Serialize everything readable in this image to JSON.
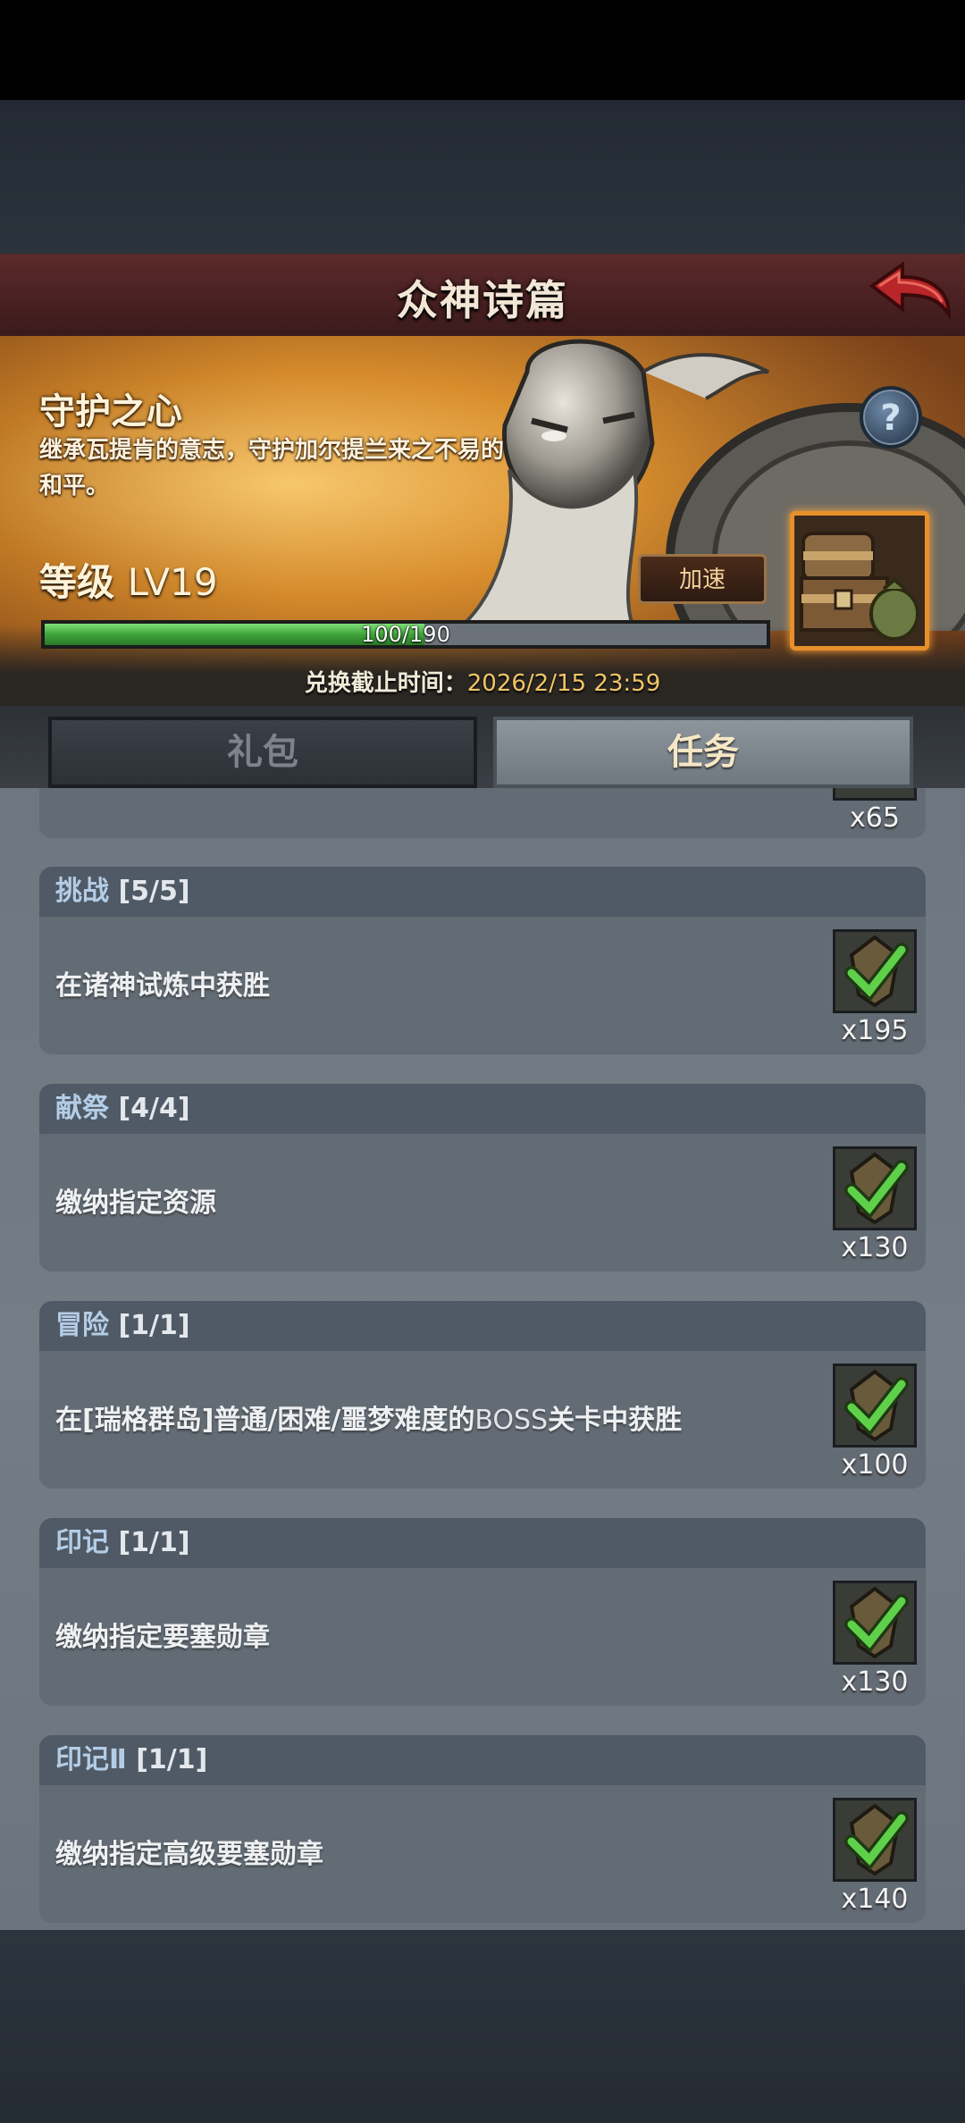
{
  "header": {
    "title": "众神诗篇"
  },
  "banner": {
    "title": "守护之心",
    "description": "继承瓦提肯的意志，守护加尔提兰来之不易的和平。",
    "level_label": "等级",
    "level_value": "LV19",
    "speed_button": "加速",
    "help_glyph": "?",
    "progress_text": "100/190",
    "progress_fraction": 0.526,
    "deadline_label": "兑换截止时间：",
    "deadline_value": "2026/2/15 23:59"
  },
  "tabs": [
    {
      "label": "礼包",
      "active": false
    },
    {
      "label": "任务",
      "active": true
    }
  ],
  "partial_top_qty": "x65",
  "tasks": [
    {
      "category": "挑战",
      "count": "[5/5]",
      "description": "在诸神试炼中获胜",
      "qty": "x195",
      "completed": true
    },
    {
      "category": "献祭",
      "count": "[4/4]",
      "description": "缴纳指定资源",
      "qty": "x130",
      "completed": true
    },
    {
      "category": "冒险",
      "count": "[1/1]",
      "description_pre": "在[瑞格群岛]普通/困难/噩梦难度的",
      "description_hl": "BOSS",
      "description_post": "关卡中获胜",
      "qty": "x100",
      "completed": true
    },
    {
      "category": "印记",
      "count": "[1/1]",
      "description": "缴纳指定要塞勋章",
      "qty": "x130",
      "completed": true
    },
    {
      "category": "印记Ⅱ",
      "count": "[1/1]",
      "description": "缴纳指定高级要塞勋章",
      "qty": "x140",
      "completed": true
    }
  ],
  "colors": {
    "progress_green": "#4cb848",
    "accent_gold": "#f2c565",
    "check_green": "#5fd04a"
  }
}
